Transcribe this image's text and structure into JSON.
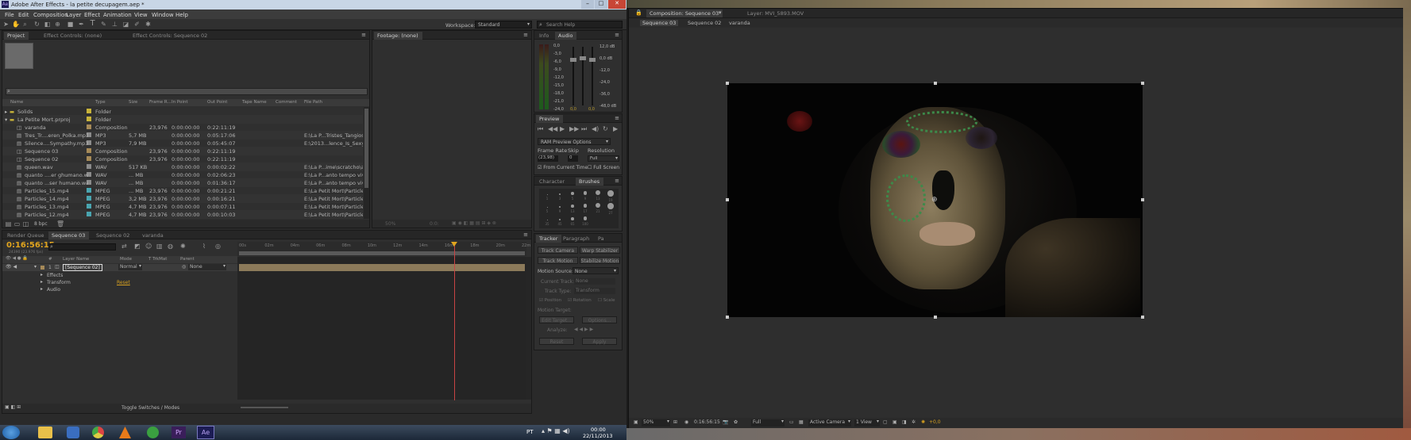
{
  "app": {
    "title": "Adobe After Effects - la petite decupagem.aep *"
  },
  "menu": [
    "File",
    "Edit",
    "Composition",
    "Layer",
    "Effect",
    "Animation",
    "View",
    "Window",
    "Help"
  ],
  "toolbar": {
    "workspace_label": "Workspace:",
    "workspace_value": "Standard",
    "search_placeholder": "Search Help"
  },
  "project": {
    "tabs": [
      "Project",
      "Effect Controls: (none)",
      "Effect Controls: Sequence 02"
    ],
    "headers": [
      "Name",
      "Type",
      "Size",
      "Frame R...",
      "In Point",
      "Out Point",
      "Tape Name",
      "Comment",
      "File Path"
    ],
    "rows": [
      {
        "name": "Solids",
        "type": "Folder",
        "size": "",
        "fr": "",
        "in": "",
        "out": "",
        "path": "",
        "color": "#c8b33a",
        "indent": 0,
        "kind": "folder"
      },
      {
        "name": "La Petite Mort.prproj",
        "type": "Folder",
        "size": "",
        "fr": "",
        "in": "",
        "out": "",
        "path": "",
        "color": "#c8b33a",
        "indent": 0,
        "kind": "folder"
      },
      {
        "name": "varanda",
        "type": "Composition",
        "size": "",
        "fr": "23,976",
        "in": "0:00:00:00",
        "out": "0:22:11:19",
        "path": "",
        "color": "#a68a58",
        "indent": 1,
        "kind": "comp"
      },
      {
        "name": "Tres_Tr....eren_Polka.mp3",
        "type": "MP3",
        "size": "5,7 MB",
        "fr": "",
        "in": "0:00:00:00",
        "out": "0:05:17:06",
        "path": "E:\\La P...Tristes_Tangios_...",
        "color": "#8b8b8b",
        "indent": 1,
        "kind": "file"
      },
      {
        "name": "Silence....Sympathy.mp3",
        "type": "MP3",
        "size": "7,9 MB",
        "fr": "",
        "in": "0:00:00:00",
        "out": "0:05:45:07",
        "path": "E:\\2013...lence_Is_Sexy_...",
        "color": "#8b8b8b",
        "indent": 1,
        "kind": "file"
      },
      {
        "name": "Sequence 03",
        "type": "Composition",
        "size": "",
        "fr": "23,976",
        "in": "0:00:00:00",
        "out": "0:22:11:19",
        "path": "",
        "color": "#a68a58",
        "indent": 1,
        "kind": "comp"
      },
      {
        "name": "Sequence 02",
        "type": "Composition",
        "size": "",
        "fr": "23,976",
        "in": "0:00:00:00",
        "out": "0:22:11:19",
        "path": "",
        "color": "#a68a58",
        "indent": 1,
        "kind": "comp"
      },
      {
        "name": "queen.wav",
        "type": "WAV",
        "size": "517 KB",
        "fr": "",
        "in": "0:00:00:00",
        "out": "0:00:02:22",
        "path": "E:\\La P...ime\\scratcho\\aco",
        "color": "#8b8b8b",
        "indent": 1,
        "kind": "file"
      },
      {
        "name": "quanto ....er ghumano.wav",
        "type": "WAV",
        "size": "... MB",
        "fr": "",
        "in": "0:00:00:00",
        "out": "0:02:06:23",
        "path": "E:\\La P...anto tempo vive ...",
        "color": "#8b8b8b",
        "indent": 1,
        "kind": "file"
      },
      {
        "name": "quanto ...ser humano.wav",
        "type": "WAV",
        "size": "... MB",
        "fr": "",
        "in": "0:00:00:00",
        "out": "0:01:36:17",
        "path": "E:\\La P...anto tempo vive ...",
        "color": "#8b8b8b",
        "indent": 1,
        "kind": "file"
      },
      {
        "name": "Particles_15.mp4",
        "type": "MPEG",
        "size": "... MB",
        "fr": "23,976",
        "in": "0:00:00:00",
        "out": "0:00:21:21",
        "path": "E:\\La Petit Mort\\Particles_1",
        "color": "#4aa5b0",
        "indent": 1,
        "kind": "file"
      },
      {
        "name": "Particles_14.mp4",
        "type": "MPEG",
        "size": "3,2 MB",
        "fr": "23,976",
        "in": "0:00:00:00",
        "out": "0:00:16:21",
        "path": "E:\\La Petit Mort\\Particles_1",
        "color": "#4aa5b0",
        "indent": 1,
        "kind": "file"
      },
      {
        "name": "Particles_13.mp4",
        "type": "MPEG",
        "size": "4,7 MB",
        "fr": "23,976",
        "in": "0:00:00:00",
        "out": "0:00:07:11",
        "path": "E:\\La Petit Mort\\Particles_1",
        "color": "#4aa5b0",
        "indent": 1,
        "kind": "file"
      },
      {
        "name": "Particles_12.mp4",
        "type": "MPEG",
        "size": "4,7 MB",
        "fr": "23,976",
        "in": "0:00:00:00",
        "out": "0:00:10:03",
        "path": "E:\\La Petit Mort\\Particles_1",
        "color": "#4aa5b0",
        "indent": 1,
        "kind": "file"
      }
    ],
    "bpc": "8 bpc"
  },
  "footage": {
    "tab": "Footage: (none)",
    "zoom": "50%",
    "time": "0:0:"
  },
  "info_audio": {
    "tabs": [
      "Info",
      "Audio"
    ],
    "left_scale": [
      "0,0",
      "-3,0",
      "-6,0",
      "-9,0",
      "-12,0",
      "-15,0",
      "-18,0",
      "-21,0",
      "-24,0"
    ],
    "right_db": [
      "12,0 dB",
      "0,0 dB",
      "-12,0",
      "-24,0",
      "-36,0",
      "-48,0 dB"
    ],
    "bottom": [
      "0,0",
      "0,0"
    ]
  },
  "preview": {
    "tab": "Preview",
    "ram_options": "RAM Preview Options",
    "frame_rate_label": "Frame Rate",
    "skip_label": "Skip",
    "resolution_label": "Resolution",
    "frame_rate_value": "(23,98)",
    "skip_value": "0",
    "resolution_value": "Full",
    "from_current": "From Current Time",
    "full_screen": "Full Screen"
  },
  "char_brushes": {
    "tabs": [
      "Character",
      "Brushes"
    ],
    "brush_sizes": [
      "1",
      "3",
      "5",
      "9",
      "13",
      "19",
      "5",
      "9",
      "13",
      "17",
      "21",
      "27",
      "35",
      "45",
      "65",
      "100"
    ]
  },
  "tracker": {
    "tabs": [
      "Tracker",
      "Paragraph",
      "Pa"
    ],
    "track_camera": "Track Camera",
    "warp_stabilizer": "Warp Stabilizer",
    "track_motion": "Track Motion",
    "stabilize_motion": "Stabilize Motion",
    "motion_source_label": "Motion Source:",
    "motion_source_value": "None",
    "current_track_label": "Current Track:",
    "current_track_value": "None",
    "track_type_label": "Track Type:",
    "track_type_value": "Transform",
    "position": "Position",
    "rotation": "Rotation",
    "scale": "Scale",
    "motion_target": "Motion Target:",
    "edit_target": "Edit Target...",
    "options": "Options...",
    "analyze": "Analyze:",
    "reset": "Reset",
    "apply": "Apply"
  },
  "timeline": {
    "tabs": [
      "Render Queue",
      "Sequence 03",
      "Sequence 02",
      "varanda"
    ],
    "timecode": "0:16:56:15",
    "timecode_sub": "24390 (23.976 fps)",
    "headers": [
      "#",
      "Layer Name",
      "Mode",
      "T TrkMat",
      "Parent"
    ],
    "layer": {
      "num": "1",
      "name": "[Sequence 02]",
      "mode": "Normal",
      "parent": "None"
    },
    "sub_rows": [
      "Effects",
      "Transform",
      "Audio"
    ],
    "reset_label": "Reset",
    "ticks": [
      "00s",
      "02m",
      "04m",
      "06m",
      "08m",
      "10m",
      "12m",
      "14m",
      "16m",
      "18m",
      "20m",
      "22m"
    ],
    "bottom": "Toggle Switches / Modes"
  },
  "comp": {
    "tabs": [
      "Composition: Sequence 03",
      "Layer: MVI_5893.MOV"
    ],
    "breadcrumbs": [
      "Sequence 03",
      "Sequence 02",
      "varanda"
    ],
    "zoom": "50%",
    "timecode": "0:16:56:15",
    "res": "Full",
    "camera": "Active Camera",
    "views": "1 View",
    "exposure": "+0,0"
  },
  "taskbar": {
    "lang": "PT",
    "time": "00:00",
    "date": "22/11/2013",
    "apps": [
      "Pr",
      "Ae"
    ]
  }
}
